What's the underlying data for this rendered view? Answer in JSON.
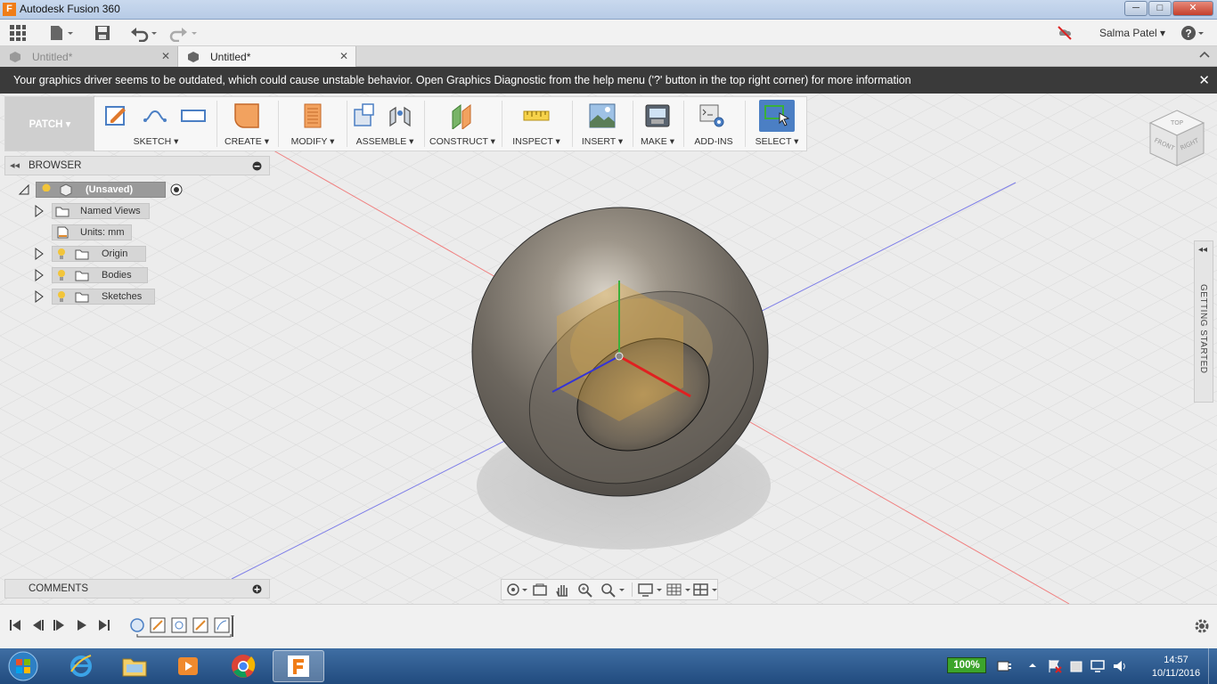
{
  "window": {
    "title": "Autodesk Fusion 360",
    "app_icon_letter": "F"
  },
  "titlebar_buttons": {
    "minimize": "─",
    "maximize": "□",
    "close": "✕"
  },
  "qat": {
    "user_name": "Salma Patel",
    "help_label": "?"
  },
  "tabs": [
    {
      "label": "Untitled*",
      "active": false
    },
    {
      "label": "Untitled*",
      "active": true
    }
  ],
  "tab_close": "✕",
  "banner": {
    "message": "Your graphics driver seems to be outdated, which could cause unstable behavior. Open Graphics Diagnostic from the help menu ('?' button in the top right corner) for more information",
    "close": "✕"
  },
  "ribbon": {
    "workspace": "PATCH ▾",
    "groups": [
      {
        "label": "SKETCH ▾"
      },
      {
        "label": "CREATE ▾"
      },
      {
        "label": "MODIFY ▾"
      },
      {
        "label": "ASSEMBLE ▾"
      },
      {
        "label": "CONSTRUCT ▾"
      },
      {
        "label": "INSPECT ▾"
      },
      {
        "label": "INSERT ▾"
      },
      {
        "label": "MAKE ▾"
      },
      {
        "label": "ADD-INS"
      },
      {
        "label": "SELECT ▾"
      }
    ]
  },
  "browser": {
    "title": "BROWSER",
    "root": "(Unsaved)",
    "items": [
      {
        "label": "Named Views"
      },
      {
        "label": "Units: mm"
      },
      {
        "label": "Origin"
      },
      {
        "label": "Bodies"
      },
      {
        "label": "Sketches"
      }
    ]
  },
  "comments": {
    "title": "COMMENTS"
  },
  "getting_started": {
    "label": "GETTING STARTED"
  },
  "viewcube": {
    "top": "TOP",
    "front": "FRONT",
    "right": "RIGHT"
  },
  "taskbar": {
    "battery": "100%",
    "time": "14:57",
    "date": "10/11/2016"
  }
}
